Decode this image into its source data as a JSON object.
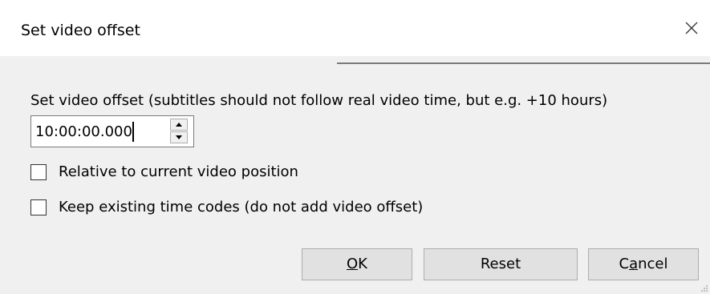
{
  "window": {
    "title": "Set video offset"
  },
  "form": {
    "description": "Set video offset (subtitles should not follow real video time, but e.g. +10 hours)",
    "offset_value": "10:00:00.000",
    "relative_checkbox": {
      "label": "Relative to current video position",
      "checked": false
    },
    "keep_codes_checkbox": {
      "label": "Keep existing time codes (do not add video offset)",
      "checked": false
    }
  },
  "buttons": {
    "ok": {
      "prefix": "",
      "mnemonic": "O",
      "suffix": "K"
    },
    "reset": "Reset",
    "cancel": {
      "prefix": "C",
      "mnemonic": "a",
      "suffix": "ncel"
    }
  },
  "icons": {
    "close": "close-icon",
    "spin_up": "triangle-up-icon",
    "spin_down": "triangle-down-icon"
  }
}
